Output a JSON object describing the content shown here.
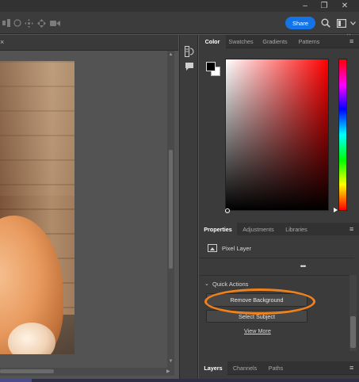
{
  "window": {
    "minimize": "–",
    "restore": "❐",
    "close": "✕"
  },
  "options_bar": {
    "share_label": "Share",
    "icons": [
      "align-icon",
      "distribute-icon",
      "3d-orbit-icon",
      "3d-pan-icon",
      "3d-slide-icon",
      "video-camera-icon"
    ],
    "search_icon": "search-icon",
    "workspace_icon": "workspace-icon"
  },
  "document": {
    "close_glyph": "×"
  },
  "icon_strip": {
    "items": [
      "history-icon",
      "comments-icon"
    ]
  },
  "color_panel": {
    "tabs": [
      "Color",
      "Swatches",
      "Gradients",
      "Patterns"
    ],
    "active_tab": "Color",
    "foreground": "#000000",
    "background": "#ffffff",
    "hue": "#ff0000"
  },
  "properties_panel": {
    "tabs": [
      "Properties",
      "Adjustments",
      "Libraries"
    ],
    "active_tab": "Properties",
    "layer_type": "Pixel Layer",
    "more_label": "•••",
    "quick_actions_label": "Quick Actions",
    "buttons": {
      "remove_background": "Remove Background",
      "select_subject": "Select Subject"
    },
    "view_more": "View More"
  },
  "layers_panel": {
    "tabs": [
      "Layers",
      "Channels",
      "Paths"
    ],
    "active_tab": "Layers"
  },
  "colors": {
    "accent": "#1473e6",
    "annotation": "#f0821e",
    "panel_bg": "#3b3b3b",
    "canvas_bg": "#535353"
  }
}
